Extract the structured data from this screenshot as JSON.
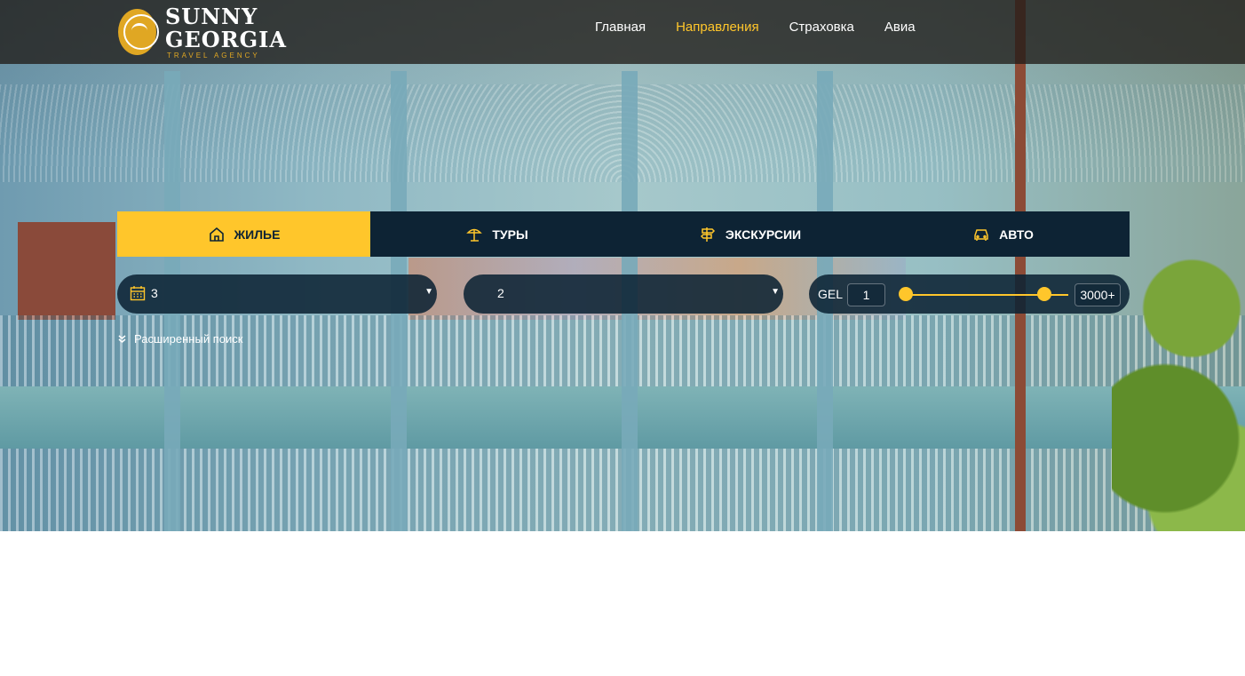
{
  "brand": {
    "name": "SUNNY GEORGIA",
    "tagline": "TRAVEL AGENCY"
  },
  "nav": {
    "items": [
      {
        "label": "Главная"
      },
      {
        "label": "Направления",
        "active": true
      },
      {
        "label": "Страховка"
      },
      {
        "label": "Авиа"
      }
    ]
  },
  "tabs": [
    {
      "label": "ЖИЛЬЕ",
      "icon": "house-icon",
      "active": true
    },
    {
      "label": "ТУРЫ",
      "icon": "beach-umbrella-icon"
    },
    {
      "label": "ЭКСКУРСИИ",
      "icon": "signpost-icon"
    },
    {
      "label": "АВТО",
      "icon": "car-icon"
    }
  ],
  "search": {
    "nights_value": "3",
    "guests_value": "2",
    "currency": "GEL",
    "price_min": "1",
    "price_max": "3000+",
    "advanced_label": "Расширенный поиск"
  },
  "colors": {
    "accent": "#ffc62b",
    "panel": "#0d2334",
    "header_bg": "#201c18"
  }
}
